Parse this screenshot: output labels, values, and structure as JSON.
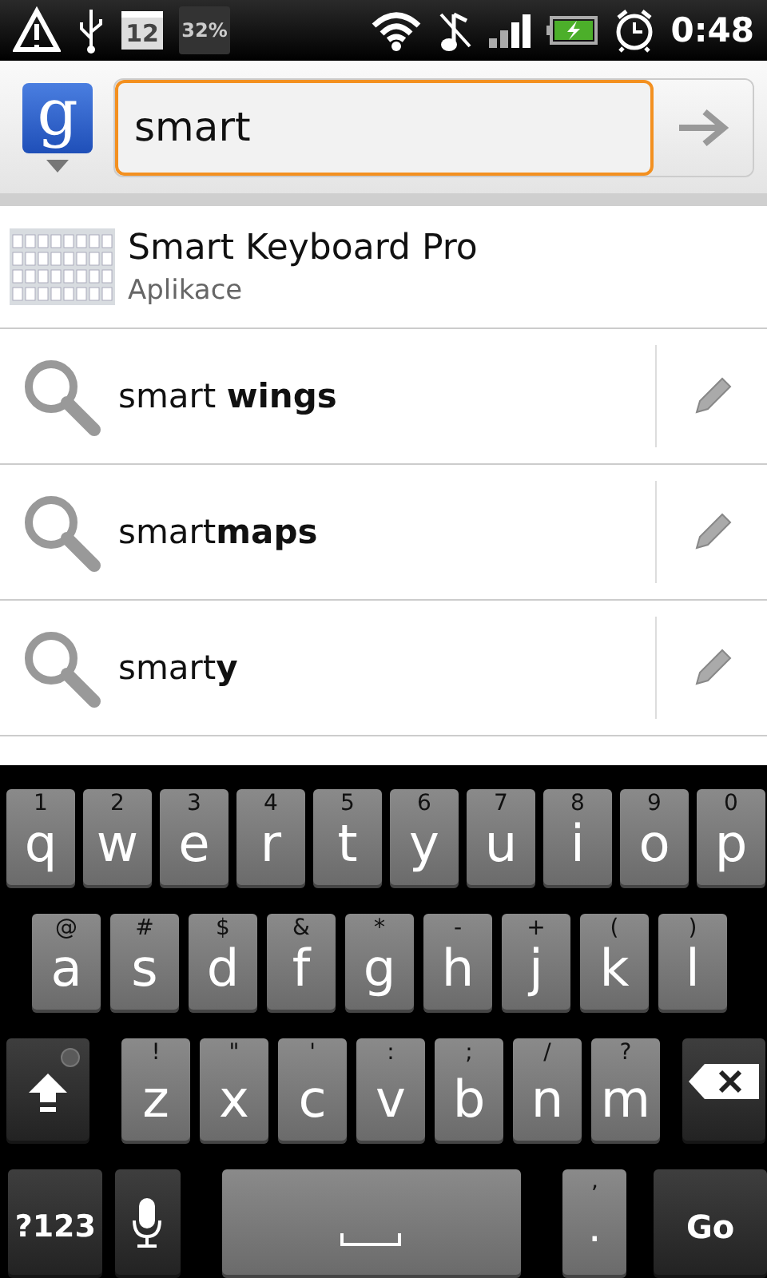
{
  "status_bar": {
    "calendar_day": "12",
    "battery_badge": "32%",
    "time": "0:48"
  },
  "search": {
    "logo": "g",
    "value": "smart"
  },
  "suggestions": [
    {
      "kind": "app",
      "title": "Smart Keyboard Pro",
      "subtitle": "Aplikace"
    },
    {
      "kind": "query",
      "text": "smart **wings**"
    },
    {
      "kind": "query",
      "text": "smart**maps**"
    },
    {
      "kind": "query",
      "text": "smart**y**"
    }
  ],
  "keyboard": {
    "rows": [
      [
        {
          "label": "q",
          "alt": "1"
        },
        {
          "label": "w",
          "alt": "2"
        },
        {
          "label": "e",
          "alt": "3"
        },
        {
          "label": "r",
          "alt": "4"
        },
        {
          "label": "t",
          "alt": "5"
        },
        {
          "label": "y",
          "alt": "6"
        },
        {
          "label": "u",
          "alt": "7"
        },
        {
          "label": "i",
          "alt": "8"
        },
        {
          "label": "o",
          "alt": "9"
        },
        {
          "label": "p",
          "alt": "0"
        }
      ],
      [
        {
          "label": "a",
          "alt": "@"
        },
        {
          "label": "s",
          "alt": "#"
        },
        {
          "label": "d",
          "alt": "$"
        },
        {
          "label": "f",
          "alt": "&"
        },
        {
          "label": "g",
          "alt": "*"
        },
        {
          "label": "h",
          "alt": "-"
        },
        {
          "label": "j",
          "alt": "+"
        },
        {
          "label": "k",
          "alt": "("
        },
        {
          "label": "l",
          "alt": ")"
        }
      ],
      [
        {
          "kind": "shift",
          "on": false
        },
        {
          "label": "z",
          "alt": "!"
        },
        {
          "label": "x",
          "alt": "\""
        },
        {
          "label": "c",
          "alt": "'"
        },
        {
          "label": "v",
          "alt": ":"
        },
        {
          "label": "b",
          "alt": ";"
        },
        {
          "label": "n",
          "alt": "/"
        },
        {
          "label": "m",
          "alt": "?"
        },
        {
          "kind": "backspace"
        }
      ],
      [
        {
          "kind": "symbols",
          "label": "?123"
        },
        {
          "kind": "mic"
        },
        {
          "kind": "space"
        },
        {
          "kind": "period",
          "label": ".",
          "alt": "’"
        },
        {
          "kind": "go",
          "label": "Go"
        }
      ]
    ]
  }
}
